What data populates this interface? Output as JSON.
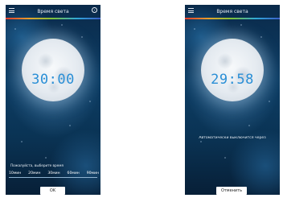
{
  "left_screen": {
    "title": "Время света",
    "timer": "30:00",
    "prompt": "Пожалуйста, выберите время",
    "options": [
      "10мин",
      "20мин",
      "30мин",
      "60мин",
      "90мин"
    ],
    "ok_label": "OK"
  },
  "right_screen": {
    "title": "Время света",
    "timer": "29:58",
    "message": "Автоматически выключится через",
    "cancel_label": "Отменить"
  }
}
